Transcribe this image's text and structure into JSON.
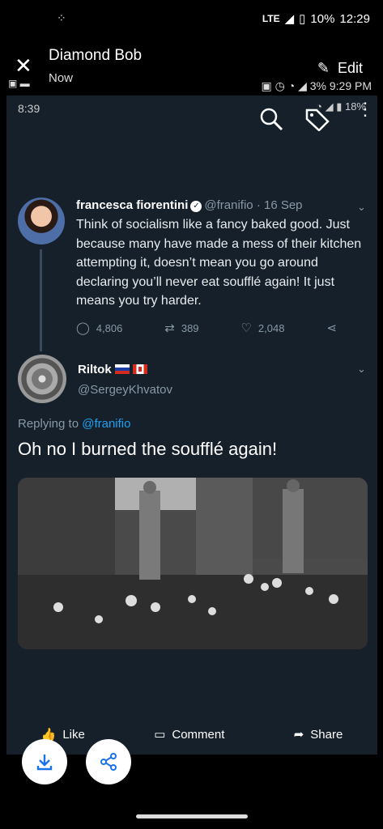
{
  "status_bar": {
    "network": "LTE",
    "battery": "10%",
    "time": "12:29"
  },
  "viewer": {
    "sender": "Diamond Bob",
    "time": "Now",
    "edit_label": "Edit",
    "orig_status": "3% 9:29 PM"
  },
  "inner_status": {
    "time": "8:39",
    "battery": "18%"
  },
  "tweet1": {
    "name": "francesca fiorentini",
    "handle": "@franifio",
    "date": "· 16 Sep",
    "text": "Think of socialism like a fancy baked good. Just because many have made a mess of their kitchen attempting it, doesn’t mean you go around declaring you’ll never eat soufflé again! It just means you try harder.",
    "replies": "4,806",
    "retweets": "389",
    "likes": "2,048"
  },
  "tweet2": {
    "name": "Riltok",
    "handle": "@SergeyKhvatov",
    "replying_prefix": "Replying to",
    "replying_handle": "@franifio",
    "text": "Oh no I burned the soufflé again!"
  },
  "viewer_actions": {
    "like": "Like",
    "comment": "Comment",
    "share": "Share"
  }
}
